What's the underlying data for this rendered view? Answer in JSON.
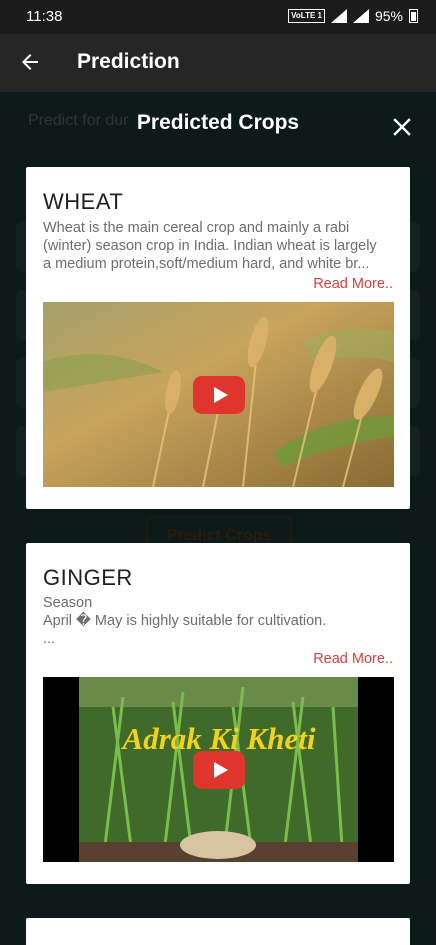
{
  "status_bar": {
    "time": "11:38",
    "network_badge": "VoLTE 1",
    "battery": "95%"
  },
  "app_bar": {
    "title": "Prediction"
  },
  "background": {
    "hint": "Predict for dur",
    "button": "Predict Crops"
  },
  "dialog": {
    "title": "Predicted Crops"
  },
  "crops": [
    {
      "name": "WHEAT",
      "description_line1": "Wheat is the main cereal crop and mainly a rabi",
      "description_line2": "(winter) season crop in India. Indian wheat is largely",
      "description_line3": "a medium protein,soft/medium hard, and white br...",
      "read_more": "Read More.."
    },
    {
      "name": "GINGER",
      "description_line1": "Season",
      "description_line2": "April � May is highly suitable for cultivation.",
      "description_line3": "...",
      "read_more": "Read More..",
      "video_caption": "Adrak Ki Kheti"
    }
  ]
}
